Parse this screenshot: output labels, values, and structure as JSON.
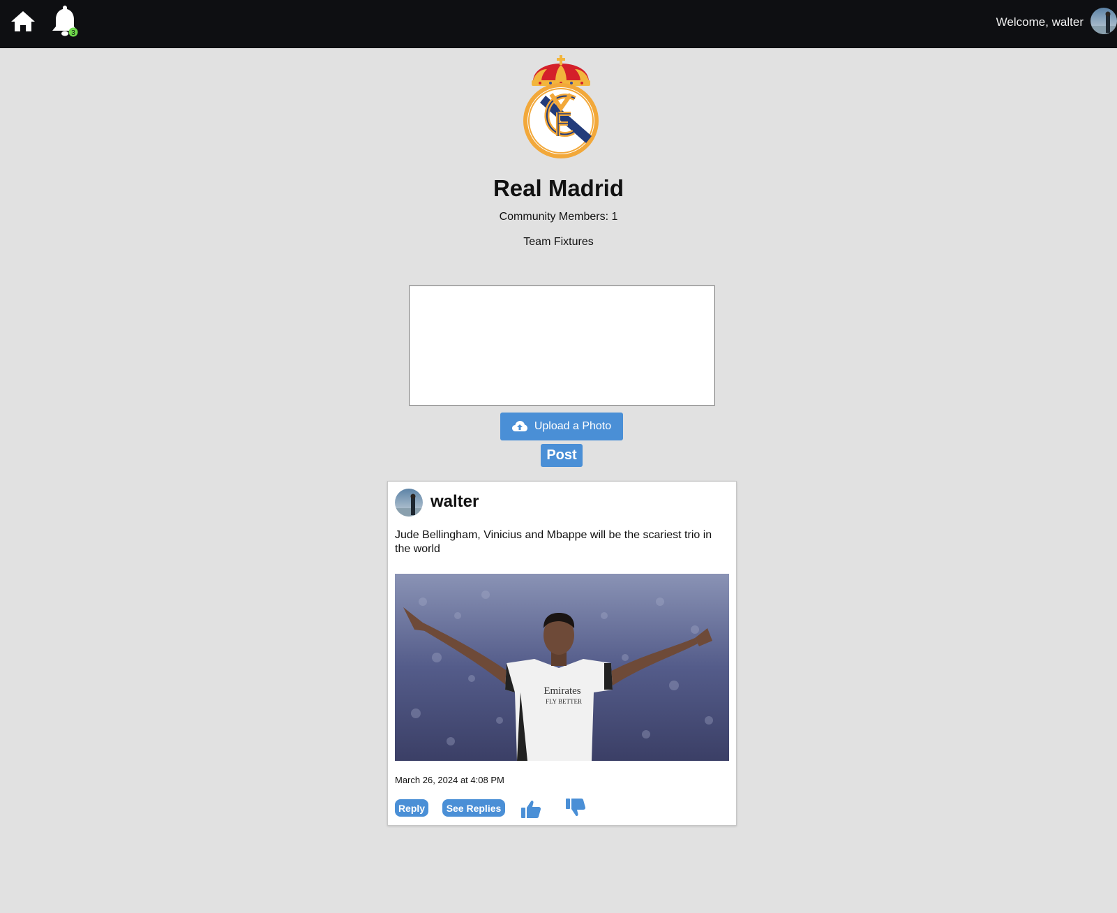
{
  "nav": {
    "home_icon": "home-icon",
    "bell_icon": "bell-icon",
    "notification_count": "3",
    "welcome_text": "Welcome, walter",
    "avatar": "user-avatar"
  },
  "community": {
    "crest": "real-madrid-crest",
    "name": "Real Madrid",
    "members_label": "Community Members: 1",
    "fixtures_link": "Team Fixtures"
  },
  "composer": {
    "placeholder": "",
    "upload_label": "Upload a Photo",
    "upload_icon": "cloud-upload-icon",
    "post_label": "Post"
  },
  "posts": [
    {
      "username": "walter",
      "text": "Jude Bellingham, Vinicius and Mbappe will be the scariest trio in the world",
      "timestamp": "March 26, 2024 at 4:08 PM",
      "photo": "player-celebration-photo",
      "photo_text_1": "Emirates",
      "photo_text_2": "FLY BETTER",
      "reply_label": "Reply",
      "see_replies_label": "See Replies",
      "like_icon": "thumbs-up-icon",
      "dislike_icon": "thumbs-down-icon"
    }
  ],
  "colors": {
    "topbar": "#0e0f12",
    "page_bg": "#e1e1e1",
    "accent": "#4a8fd6",
    "badge": "#6ed94a"
  }
}
